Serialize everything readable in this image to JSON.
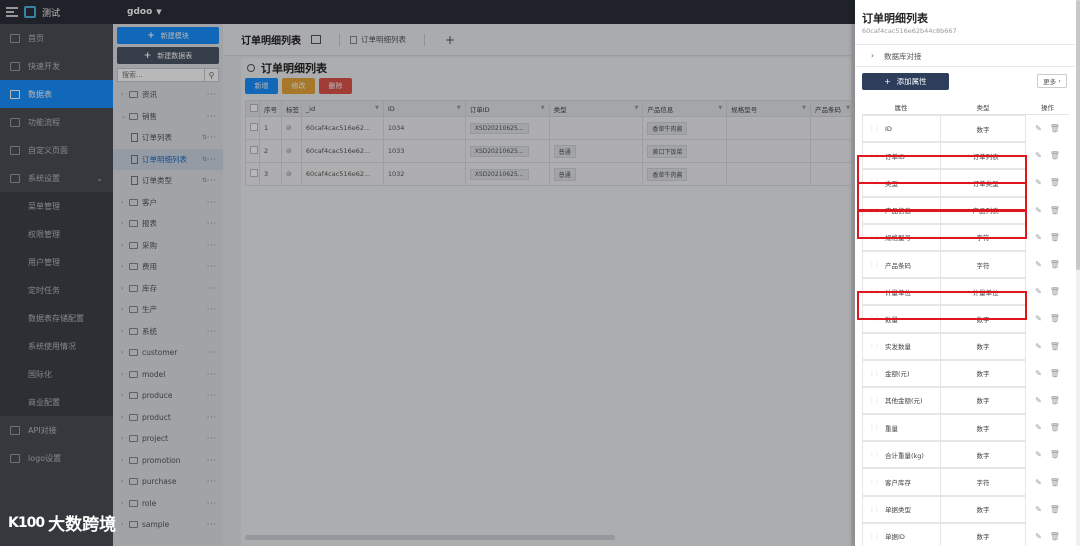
{
  "app": {
    "name": "测试",
    "workspace": "gdoo"
  },
  "nav": {
    "items": [
      {
        "label": "首页",
        "active": false
      },
      {
        "label": "快速开发",
        "active": false
      },
      {
        "label": "数据表",
        "active": true
      },
      {
        "label": "功能流程",
        "active": false
      },
      {
        "label": "自定义页面",
        "active": false
      },
      {
        "label": "系统设置",
        "active": false,
        "expanded": true
      }
    ],
    "sub_items": [
      "菜单管理",
      "权限管理",
      "用户管理",
      "定时任务",
      "数据表存储配置",
      "系统使用情况",
      "国际化",
      "商业配置"
    ],
    "bottom_items": [
      "API对接",
      "logo设置"
    ]
  },
  "tree": {
    "new_module": "新建模块",
    "new_table": "新建数据表",
    "search_placeholder": "搜索...",
    "nodes": [
      {
        "label": "资讯",
        "type": "folder",
        "expanded": false
      },
      {
        "label": "销售",
        "type": "folder",
        "expanded": true
      },
      {
        "label": "订单列表",
        "type": "leaf",
        "selected": false
      },
      {
        "label": "订单明细列表",
        "type": "leaf",
        "selected": true
      },
      {
        "label": "订单类型",
        "type": "leaf",
        "selected": false
      },
      {
        "label": "客户",
        "type": "folder",
        "expanded": false
      },
      {
        "label": "报表",
        "type": "folder",
        "expanded": false
      },
      {
        "label": "采购",
        "type": "folder",
        "expanded": false
      },
      {
        "label": "费用",
        "type": "folder",
        "expanded": false
      },
      {
        "label": "库存",
        "type": "folder",
        "expanded": false
      },
      {
        "label": "生产",
        "type": "folder",
        "expanded": false
      },
      {
        "label": "系统",
        "type": "folder",
        "expanded": false
      },
      {
        "label": "customer",
        "type": "folder",
        "expanded": false
      },
      {
        "label": "model",
        "type": "folder",
        "expanded": false
      },
      {
        "label": "produce",
        "type": "folder",
        "expanded": false
      },
      {
        "label": "product",
        "type": "folder",
        "expanded": false
      },
      {
        "label": "project",
        "type": "folder",
        "expanded": false
      },
      {
        "label": "promotion",
        "type": "folder",
        "expanded": false
      },
      {
        "label": "purchase",
        "type": "folder",
        "expanded": false
      },
      {
        "label": "role",
        "type": "folder",
        "expanded": false
      },
      {
        "label": "sample",
        "type": "folder",
        "expanded": false
      }
    ]
  },
  "main": {
    "tab_title": "订单明细列表",
    "open_tab": "订单明细列表",
    "panel_title": "订单明细列表",
    "actions": {
      "add": "新增",
      "edit": "修改",
      "delete": "删除"
    },
    "columns": [
      "序号",
      "标签",
      "_id",
      "ID",
      "订单ID",
      "类型",
      "产品信息",
      "规格型号",
      "产品条码"
    ],
    "rows": [
      {
        "index": "1",
        "_id": "60caf4cac516e62...",
        "id": "1034",
        "order": "XSD20210625...",
        "type": "",
        "product": "香草牛肉酱"
      },
      {
        "index": "2",
        "_id": "60caf4cac516e62...",
        "id": "1033",
        "order": "XSD20210625...",
        "type": "普通",
        "product": "黄口下饭菜"
      },
      {
        "index": "3",
        "_id": "60caf4cac516e62...",
        "id": "1032",
        "order": "XSD20210625...",
        "type": "普通",
        "product": "香草牛肉酱"
      }
    ]
  },
  "drawer": {
    "title": "订单明细列表",
    "id": "60caf4cac516e62b44c8b667",
    "db_link": "数据库对接",
    "add_property": "添加属性",
    "more": "更多",
    "columns": {
      "property": "属性",
      "type": "类型",
      "actions": "操作"
    },
    "fields": [
      {
        "name": "ID",
        "type": "数字",
        "highlighted": false
      },
      {
        "name": "订单ID",
        "type": "* 订单列表",
        "highlighted": true
      },
      {
        "name": "类型",
        "type": "* 订单类型",
        "highlighted": true
      },
      {
        "name": "产品信息",
        "type": "* 产品列表",
        "highlighted": true
      },
      {
        "name": "规格型号",
        "type": "字符",
        "highlighted": false
      },
      {
        "name": "产品条码",
        "type": "字符",
        "highlighted": false
      },
      {
        "name": "计量单位",
        "type": "* 计量单位",
        "highlighted": true
      },
      {
        "name": "数量",
        "type": "数字",
        "highlighted": false
      },
      {
        "name": "实发数量",
        "type": "数字",
        "highlighted": false
      },
      {
        "name": "金额(元)",
        "type": "数字",
        "highlighted": false
      },
      {
        "name": "其他金额(元)",
        "type": "数字",
        "highlighted": false
      },
      {
        "name": "重量",
        "type": "数字",
        "highlighted": false
      },
      {
        "name": "合计重量(kg)",
        "type": "数字",
        "highlighted": false
      },
      {
        "name": "客户库存",
        "type": "字符",
        "highlighted": false
      },
      {
        "name": "单据类型",
        "type": "数字",
        "highlighted": false
      },
      {
        "name": "单据ID",
        "type": "数字",
        "highlighted": false
      }
    ]
  },
  "watermark": {
    "mark": "K100",
    "text": "大数跨境"
  },
  "colors": {
    "primary": "#1890ff",
    "highlight": "#e0161e",
    "nav_bg": "#4a4f57",
    "add_button": "#2c3e5c"
  }
}
